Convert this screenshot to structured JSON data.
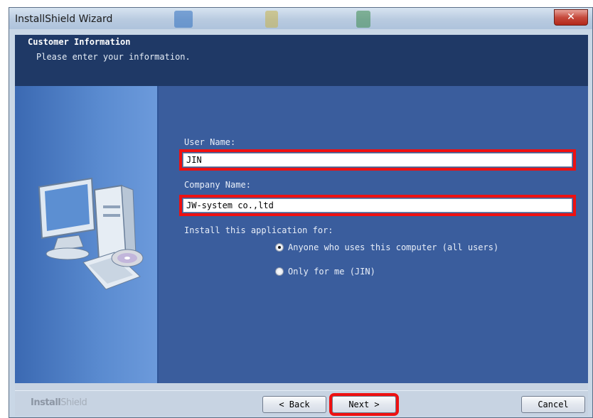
{
  "window": {
    "title": "InstallShield Wizard",
    "close_label": "✕"
  },
  "header": {
    "title": "Customer Information",
    "subtitle": "Please enter your information."
  },
  "form": {
    "user_name_label": "User Name:",
    "user_name_value": "JIN",
    "company_name_label": "Company Name:",
    "company_name_value": "JW-system co.,ltd",
    "install_for_label": "Install this application for:",
    "options": [
      {
        "label": "Anyone who uses this computer (all users)",
        "checked": true
      },
      {
        "label": "Only for me (JIN)",
        "checked": false
      }
    ]
  },
  "footer": {
    "brand_bold": "Install",
    "brand_light": "Shield",
    "back_label": "< Back",
    "next_label": "Next >",
    "cancel_label": "Cancel"
  },
  "colors": {
    "header_bg": "#1f3966",
    "content_bg": "#3a5d9d",
    "highlight": "#ee1111"
  },
  "icons": [
    "computer-icon",
    "cd-disc-icon",
    "close-icon"
  ]
}
